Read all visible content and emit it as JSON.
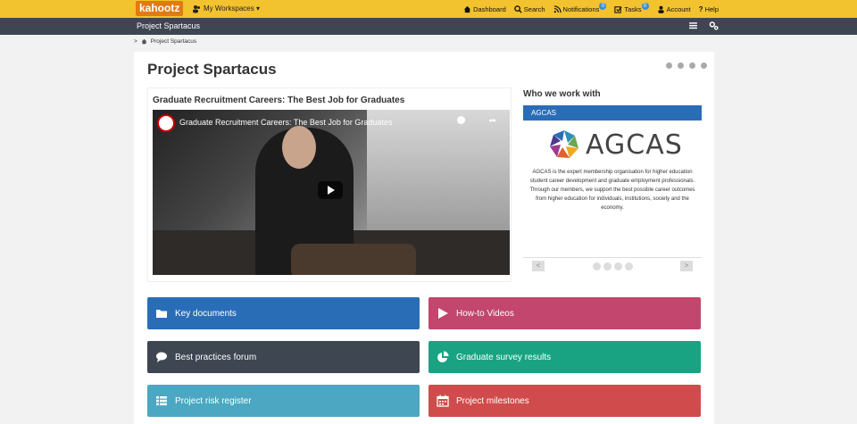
{
  "topbar": {
    "logo": "kahootz",
    "workspaces": "My Workspaces ▾",
    "nav": {
      "dashboard": "Dashboard",
      "search": "Search",
      "notifications": "Notifications",
      "notifications_count": "0",
      "tasks": "Tasks",
      "tasks_count": "0",
      "account": "Account",
      "help": "Help"
    }
  },
  "project_bar": {
    "title": "Project Spartacus"
  },
  "breadcrumb": {
    "arrow": ">",
    "current": "Project Spartacus"
  },
  "main": {
    "title": "Project Spartacus",
    "video": {
      "heading": "Graduate Recruitment Careers: The Best Job for Graduates",
      "overlay_title": "Graduate Recruitment Careers: The Best Job for Graduates"
    },
    "who": {
      "title": "Who we work with",
      "tab": "AGCAS",
      "logo_text": "AGCAS",
      "description": "AGCAS is the expert membership organisation for higher education student career development and graduate employment professionals. Through our members, we support the best possible career outcomes from higher education for individuals, institutions, society and the economy.",
      "prev": "<",
      "next": ">"
    },
    "tiles": [
      {
        "label": "Key documents",
        "icon": "folder-icon",
        "color": "#2a6db7"
      },
      {
        "label": "How-to Videos",
        "icon": "play-icon",
        "color": "#c2466d"
      },
      {
        "label": "Best practices forum",
        "icon": "comment-icon",
        "color": "#3d4651"
      },
      {
        "label": "Graduate survey results",
        "icon": "pie-chart-icon",
        "color": "#1aa383"
      },
      {
        "label": "Project risk register",
        "icon": "list-icon",
        "color": "#4ba7c2"
      },
      {
        "label": "Project milestones",
        "icon": "calendar-icon",
        "color": "#d04b4b"
      }
    ]
  }
}
